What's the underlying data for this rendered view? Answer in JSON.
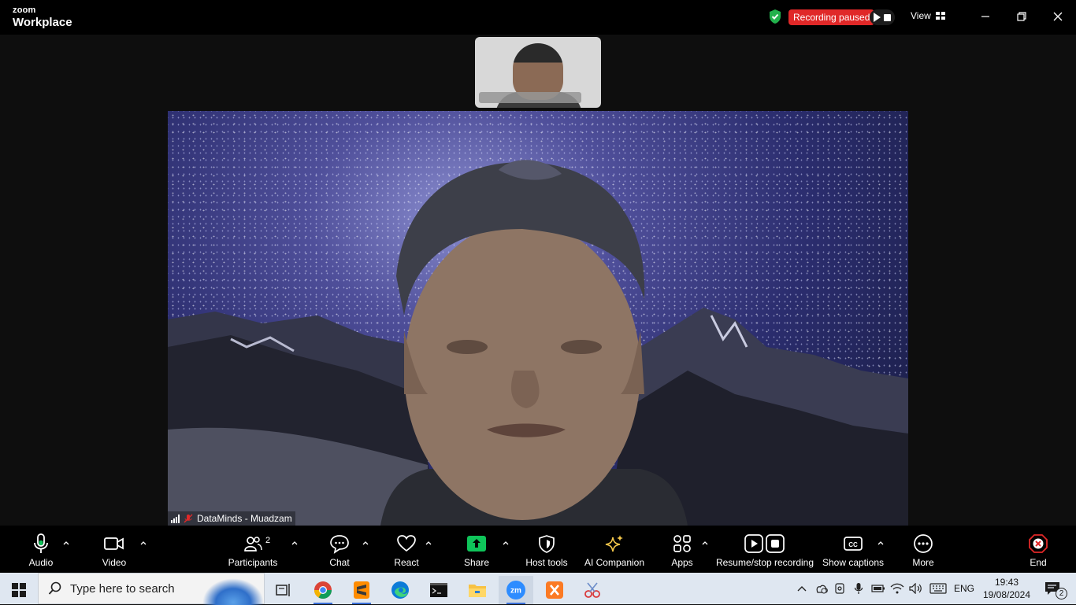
{
  "titlebar": {
    "brand_small": "zoom",
    "brand_large": "Workplace",
    "recording_status": "Recording paused",
    "view_label": "View"
  },
  "stage": {
    "thumbnail_name": "",
    "main_participant": "DataMinds - Muadzam"
  },
  "toolbar": {
    "audio": "Audio",
    "video": "Video",
    "participants": "Participants",
    "participants_count": "2",
    "chat": "Chat",
    "react": "React",
    "share": "Share",
    "host_tools": "Host tools",
    "ai_companion": "AI Companion",
    "apps": "Apps",
    "record": "Resume/stop recording",
    "captions": "Show captions",
    "more": "More",
    "end": "End"
  },
  "taskbar": {
    "search_placeholder": "Type here to search",
    "language": "ENG",
    "time": "19:43",
    "date": "19/08/2024",
    "notification_count": "2",
    "apps": [
      "task-view",
      "chrome",
      "sublime-text",
      "edge",
      "terminal",
      "file-explorer",
      "zoom",
      "xampp",
      "snipping-tool"
    ]
  },
  "colors": {
    "recording_red": "#e02828",
    "share_green": "#0fc45a",
    "shield_green": "#22b14c",
    "end_red": "#e02828",
    "ai_gold": "#f3c64a"
  }
}
